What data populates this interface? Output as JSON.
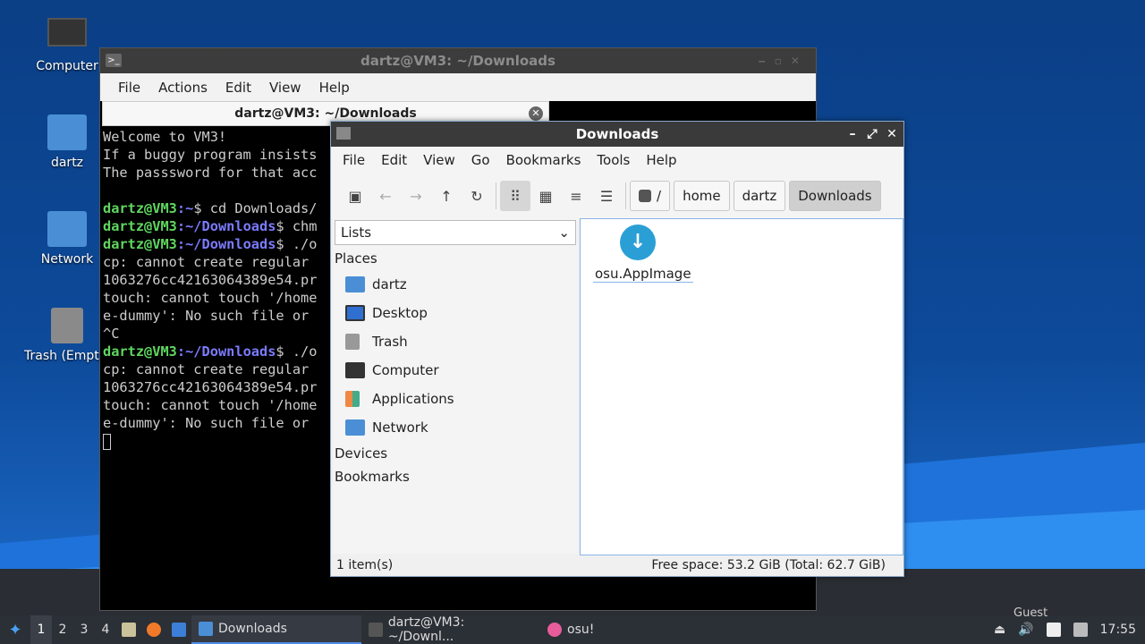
{
  "desktop": {
    "icons": [
      {
        "label": "Computer"
      },
      {
        "label": "dartz"
      },
      {
        "label": "Network"
      },
      {
        "label": "Trash (Empty)"
      }
    ]
  },
  "terminal": {
    "title": "dartz@VM3: ~/Downloads",
    "menu": [
      "File",
      "Actions",
      "Edit",
      "View",
      "Help"
    ],
    "tab_label": "dartz@VM3: ~/Downloads",
    "lines": {
      "l1": "Welcome to VM3!",
      "l2": "If a buggy program insists",
      "l3": "The passsword for that acc",
      "p1_user": "dartz@VM3",
      "p1_path": ":~",
      "p1_cmd": "$ cd Downloads/",
      "p2_user": "dartz@VM3",
      "p2_path": ":~/Downloads",
      "p2_cmd": "$ chm",
      "p3_user": "dartz@VM3",
      "p3_path": ":~/Downloads",
      "p3_cmd": "$ ./o",
      "l4": "cp: cannot create regular",
      "l5": "1063276cc42163064389e54.pr",
      "l6": "touch: cannot touch '/home",
      "l7": "e-dummy': No such file or",
      "l8": "^C",
      "p4_user": "dartz@VM3",
      "p4_path": ":~/Downloads",
      "p4_cmd": "$ ./o",
      "l9": "cp: cannot create regular",
      "l10": "1063276cc42163064389e54.pr",
      "l11": "touch: cannot touch '/home",
      "l12": "e-dummy': No such file or"
    }
  },
  "filemanager": {
    "title": "Downloads",
    "menu": [
      "File",
      "Edit",
      "View",
      "Go",
      "Bookmarks",
      "Tools",
      "Help"
    ],
    "breadcrumbs": [
      "/",
      "home",
      "dartz",
      "Downloads"
    ],
    "side_select": "Lists",
    "sections": {
      "places": "Places",
      "devices": "Devices",
      "bookmarks": "Bookmarks"
    },
    "places": [
      "dartz",
      "Desktop",
      "Trash",
      "Computer",
      "Applications",
      "Network"
    ],
    "files": [
      {
        "name": "osu.AppImage"
      }
    ],
    "status_left": "1 item(s)",
    "status_right": "Free space: 53.2 GiB (Total: 62.7 GiB)"
  },
  "taskbar": {
    "workspaces": [
      "1",
      "2",
      "3",
      "4"
    ],
    "tasks": [
      "Downloads",
      "dartz@VM3: ~/Downl...",
      "osu!"
    ],
    "user": "Guest",
    "time": "17:55"
  }
}
